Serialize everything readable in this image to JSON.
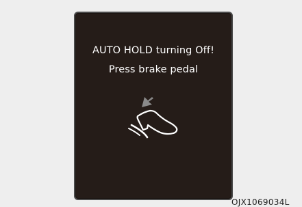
{
  "message": {
    "line1": "AUTO HOLD turning Off!",
    "line2": "Press brake pedal"
  },
  "illustration": {
    "icon": "brake-pedal-press-icon"
  },
  "image_code": "OJX1069034L",
  "colors": {
    "display_background": "#251c18",
    "text": "#ffffff",
    "arrow": "#8a8a8a"
  }
}
